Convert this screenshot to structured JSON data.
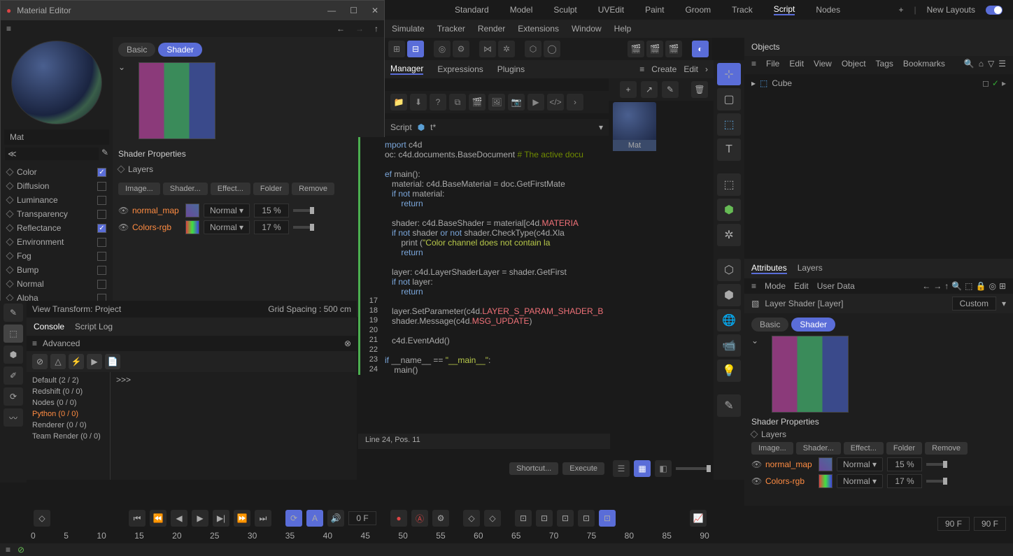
{
  "top_tabs": [
    "Standard",
    "Model",
    "Sculpt",
    "UVEdit",
    "Paint",
    "Groom",
    "Track",
    "Script",
    "Nodes"
  ],
  "top_active": "Script",
  "top_right": {
    "new_layouts": "New Layouts",
    "plus": "+"
  },
  "menubar": [
    "Simulate",
    "Tracker",
    "Render",
    "Extensions",
    "Window",
    "Help"
  ],
  "material_editor": {
    "title": "Material Editor",
    "mat_name": "Mat",
    "tabs": {
      "basic": "Basic",
      "shader": "Shader"
    },
    "channels": [
      "Color",
      "Diffusion",
      "Luminance",
      "Transparency",
      "Reflectance",
      "Environment",
      "Fog",
      "Bump",
      "Normal",
      "Alpha"
    ],
    "channels_checked": [
      "Color",
      "Reflectance"
    ],
    "channels_active": "Color",
    "shader_props": "Shader Properties",
    "layers": "Layers",
    "buttons": [
      "Image...",
      "Shader...",
      "Effect...",
      "Folder",
      "Remove"
    ],
    "layer_rows": [
      {
        "name": "normal_map",
        "blend": "Normal",
        "pct": "15 %"
      },
      {
        "name": "Colors-rgb",
        "blend": "Normal",
        "pct": "17 %"
      }
    ]
  },
  "script_manager": {
    "tab": "Manager",
    "tabs": [
      "Manager",
      "Expressions",
      "Plugins"
    ],
    "script_label": "Script",
    "script_name": "t*",
    "create": "Create",
    "edit": "Edit"
  },
  "code_lines": [
    {
      "n": "",
      "t": [
        {
          "c": "k-kw",
          "v": "mport"
        },
        {
          "c": "",
          "v": " c4d"
        }
      ]
    },
    {
      "n": "",
      "t": [
        {
          "c": "",
          "v": "oc: c4d.documents.BaseDocument "
        },
        {
          "c": "k-cmt",
          "v": "# The active docu"
        }
      ]
    },
    {
      "n": "",
      "t": [
        {
          "c": "",
          "v": ""
        }
      ]
    },
    {
      "n": "",
      "t": [
        {
          "c": "k-kw",
          "v": "ef"
        },
        {
          "c": "",
          "v": " main():"
        }
      ]
    },
    {
      "n": "",
      "t": [
        {
          "c": "",
          "v": "   material: c4d.BaseMaterial = doc.GetFirstMate"
        }
      ]
    },
    {
      "n": "",
      "t": [
        {
          "c": "",
          "v": "   "
        },
        {
          "c": "k-kw",
          "v": "if not"
        },
        {
          "c": "",
          "v": " material:"
        }
      ]
    },
    {
      "n": "",
      "t": [
        {
          "c": "",
          "v": "       "
        },
        {
          "c": "k-kw",
          "v": "return"
        }
      ]
    },
    {
      "n": "",
      "t": [
        {
          "c": "",
          "v": ""
        }
      ]
    },
    {
      "n": "",
      "t": [
        {
          "c": "",
          "v": "   shader: c4d.BaseShader = material[c4d."
        },
        {
          "c": "k-const",
          "v": "MATERIA"
        }
      ]
    },
    {
      "n": "",
      "t": [
        {
          "c": "",
          "v": "   "
        },
        {
          "c": "k-kw",
          "v": "if not"
        },
        {
          "c": "",
          "v": " shader "
        },
        {
          "c": "k-kw",
          "v": "or not"
        },
        {
          "c": "",
          "v": " shader.CheckType(c4d.Xla"
        }
      ]
    },
    {
      "n": "",
      "t": [
        {
          "c": "",
          "v": "       print ("
        },
        {
          "c": "k-str",
          "v": "\"Color channel does not contain la"
        }
      ]
    },
    {
      "n": "",
      "t": [
        {
          "c": "",
          "v": "       "
        },
        {
          "c": "k-kw",
          "v": "return"
        }
      ]
    },
    {
      "n": "",
      "t": [
        {
          "c": "",
          "v": ""
        }
      ]
    },
    {
      "n": "",
      "t": [
        {
          "c": "",
          "v": "   layer: c4d.LayerShaderLayer = shader.GetFirst"
        }
      ]
    },
    {
      "n": "",
      "t": [
        {
          "c": "",
          "v": "   "
        },
        {
          "c": "k-kw",
          "v": "if not"
        },
        {
          "c": "",
          "v": " layer:"
        }
      ]
    },
    {
      "n": "",
      "t": [
        {
          "c": "",
          "v": "       "
        },
        {
          "c": "k-kw",
          "v": "return"
        }
      ]
    },
    {
      "n": "17",
      "t": [
        {
          "c": "",
          "v": ""
        }
      ]
    },
    {
      "n": "18",
      "t": [
        {
          "c": "",
          "v": "   layer.SetParameter(c4d."
        },
        {
          "c": "k-const",
          "v": "LAYER_S_PARAM_SHADER_B"
        }
      ]
    },
    {
      "n": "19",
      "t": [
        {
          "c": "",
          "v": "   shader.Message(c4d."
        },
        {
          "c": "k-const",
          "v": "MSG_UPDATE"
        },
        {
          "c": "",
          "v": ")"
        }
      ]
    },
    {
      "n": "20",
      "t": [
        {
          "c": "",
          "v": ""
        }
      ]
    },
    {
      "n": "21",
      "t": [
        {
          "c": "",
          "v": "   c4d.EventAdd()"
        }
      ]
    },
    {
      "n": "22",
      "t": [
        {
          "c": "",
          "v": ""
        }
      ]
    },
    {
      "n": "23",
      "t": [
        {
          "c": "k-kw",
          "v": "if"
        },
        {
          "c": "",
          "v": " __name__ == "
        },
        {
          "c": "k-str",
          "v": "\"__main__\""
        },
        {
          "c": "",
          "v": ":"
        }
      ]
    },
    {
      "n": "24",
      "t": [
        {
          "c": "",
          "v": "    main()"
        }
      ]
    }
  ],
  "code_status": "Line 24, Pos. 11",
  "code_buttons": {
    "shortcut": "Shortcut...",
    "execute": "Execute"
  },
  "mat_label": "Mat",
  "viewinfo": {
    "transform": "View Transform: Project",
    "grid": "Grid Spacing : 500 cm"
  },
  "console": {
    "tabs": [
      "Console",
      "Script Log"
    ],
    "active": "Console",
    "filter": "Advanced",
    "cats": [
      "Default (2 / 2)",
      "Redshift (0 / 0)",
      "Nodes (0 / 0)",
      "Python (0 / 0)",
      "Renderer (0 / 0)",
      "Team Render  (0 / 0)"
    ],
    "cats_sel": "Python (0 / 0)",
    "prompt": ">>>"
  },
  "objects": {
    "title": "Objects",
    "menu": [
      "File",
      "Edit",
      "View",
      "Object",
      "Tags",
      "Bookmarks"
    ],
    "tree": [
      {
        "name": "Cube"
      }
    ]
  },
  "attributes": {
    "tabs": [
      "Attributes",
      "Layers"
    ],
    "active": "Attributes",
    "menu": [
      "Mode",
      "Edit",
      "User Data"
    ],
    "head": "Layer Shader [Layer]",
    "custom": "Custom",
    "subtabs": {
      "basic": "Basic",
      "shader": "Shader"
    },
    "shader_props": "Shader Properties",
    "layers": "Layers",
    "buttons": [
      "Image...",
      "Shader...",
      "Effect...",
      "Folder",
      "Remove"
    ],
    "layer_rows": [
      {
        "name": "normal_map",
        "blend": "Normal",
        "pct": "15 %"
      },
      {
        "name": "Colors-rgb",
        "blend": "Normal",
        "pct": "17 %"
      }
    ]
  },
  "timeline": {
    "frame": "0 F",
    "end": "90 F",
    "end2": "90 F",
    "zero": "0 F",
    "zero2": "0 F",
    "ticks": [
      "0",
      "5",
      "10",
      "15",
      "20",
      "25",
      "30",
      "35",
      "40",
      "45",
      "50",
      "55",
      "60",
      "65",
      "70",
      "75",
      "80",
      "85",
      "90"
    ]
  }
}
